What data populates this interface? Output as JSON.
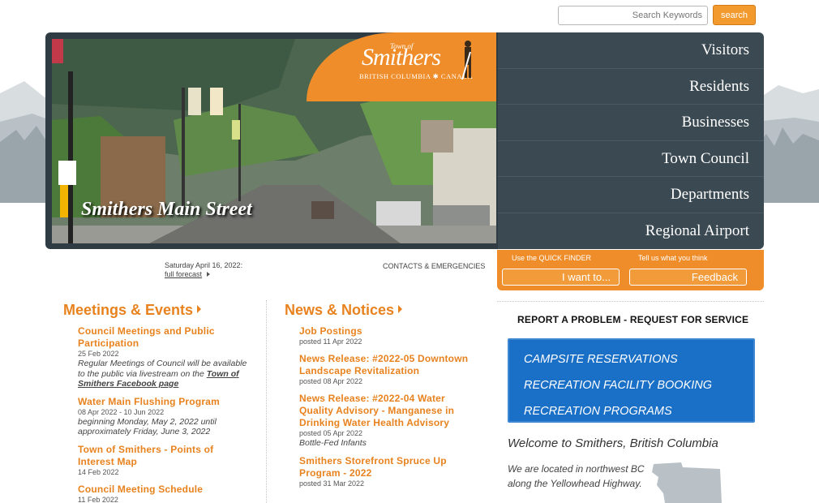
{
  "search": {
    "placeholder": "Search Keywords",
    "button": "search"
  },
  "header": {
    "logo_town_of": "Town of",
    "logo_name": "Smithers",
    "logo_province": "BRITISH COLUMBIA ✱ CANADA",
    "hero_caption": "Smithers Main Street"
  },
  "nav": {
    "items": [
      "Visitors",
      "Residents",
      "Businesses",
      "Town Council",
      "Departments",
      "Regional Airport"
    ]
  },
  "finder": {
    "quick_label": "Use the QUICK FINDER",
    "quick_button": "I want to...",
    "feedback_label": "Tell us what you think",
    "feedback_button": "Feedback"
  },
  "info_bar": {
    "date": "Saturday April 16, 2022:",
    "forecast_link": "full forecast",
    "contacts_link": "CONTACTS & EMERGENCIES"
  },
  "meetings": {
    "title": "Meetings & Events",
    "items": [
      {
        "title": "Council Meetings and Public Participation",
        "date": "25 Feb 2022",
        "desc": "Regular Meetings of Council will be available to the public via livestream on the",
        "desc_link": "Town of Smithers Facebook page"
      },
      {
        "title": "Water Main Flushing Program",
        "date": "08 Apr 2022 - 10 Jun 2022",
        "desc": "beginning Monday, May 2, 2022 until approximately Friday, June 3, 2022"
      },
      {
        "title": "Town of Smithers - Points of Interest Map",
        "date": "14 Feb 2022"
      },
      {
        "title": "Council Meeting Schedule",
        "date": "11 Feb 2022"
      }
    ]
  },
  "news": {
    "title": "News & Notices",
    "items": [
      {
        "title": "Job Postings",
        "date": "posted 11 Apr 2022"
      },
      {
        "title": "News Release: #2022-05 Downtown Landscape Revitalization",
        "date": "posted 08 Apr 2022"
      },
      {
        "title": "News Release: #2022-04 Water Quality Advisory - Manganese in Drinking Water Health Advisory",
        "date": "posted 05 Apr 2022",
        "desc": "Bottle-Fed Infants"
      },
      {
        "title": "Smithers Storefront Spruce Up Program - 2022",
        "date": "posted 31 Mar 2022"
      }
    ]
  },
  "sidebar": {
    "report_link": "REPORT A PROBLEM - REQUEST FOR SERVICE",
    "blue_links": [
      "CAMPSITE RESERVATIONS",
      "RECREATION FACILITY BOOKING",
      "RECREATION PROGRAMS"
    ],
    "welcome_title": "Welcome to Smithers, British Columbia",
    "welcome_text": "We are located in northwest BC along the Yellowhead Highway."
  },
  "colors": {
    "accent_orange": "#e8821e",
    "nav_slate": "#3b4952",
    "link_blue": "#1a6fc6"
  }
}
